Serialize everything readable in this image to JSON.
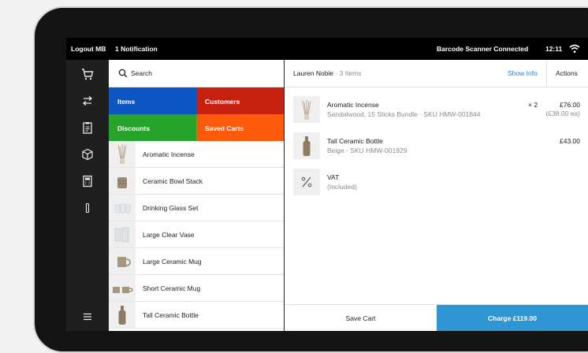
{
  "statusbar": {
    "logout_label": "Logout MB",
    "notifications_label": "1 Notification",
    "scanner_status": "Barcode Scanner Connected",
    "time": "12:11",
    "wifi_icon": "wifi-icon"
  },
  "sidebar": {
    "items": [
      {
        "name": "cart",
        "icon": "cart-icon"
      },
      {
        "name": "transactions",
        "icon": "arrows-swap-icon"
      },
      {
        "name": "reports",
        "icon": "clipboard-icon"
      },
      {
        "name": "items",
        "icon": "box-icon"
      },
      {
        "name": "calculator",
        "icon": "calculator-icon"
      },
      {
        "name": "device",
        "icon": "device-icon"
      },
      {
        "name": "menu",
        "icon": "hamburger-menu-icon"
      }
    ]
  },
  "catalog": {
    "search_label": "Search",
    "tiles": [
      {
        "label": "Items",
        "color": "#0e55c4"
      },
      {
        "label": "Customers",
        "color": "#c8200e"
      },
      {
        "label": "Discounts",
        "color": "#27a52a"
      },
      {
        "label": "Saved Carts",
        "color": "#ff5a0a"
      }
    ],
    "items": [
      {
        "name": "Aromatic Incense",
        "icon": "incense-icon"
      },
      {
        "name": "Ceramic Bowl Stack",
        "icon": "bowl-stack-icon"
      },
      {
        "name": "Drinking Glass Set",
        "icon": "glass-set-icon"
      },
      {
        "name": "Large Clear Vase",
        "icon": "vase-icon"
      },
      {
        "name": "Large Ceramic Mug",
        "icon": "mug-icon"
      },
      {
        "name": "Short Ceramic Mug",
        "icon": "mug-pair-icon"
      },
      {
        "name": "Tall Ceramic Bottle",
        "icon": "bottle-icon"
      }
    ]
  },
  "cart": {
    "customer": "Lauren Noble",
    "item_count": "· 3 Items",
    "show_info_label": "Show Info",
    "actions_label": "Actions",
    "lines": [
      {
        "name": "Aromatic Incense",
        "description": "Sandalwood, 15 Sticks Bundle · SKU HMW-001844",
        "qty": "× 2",
        "price": "£76.00",
        "sub": "(£38.00 ea)",
        "icon": "incense-icon"
      },
      {
        "name": "Tall Ceramic Bottle",
        "description": "Beige · SKU HMW-001929",
        "qty": "",
        "price": "£43.00",
        "sub": "",
        "icon": "bottle-icon"
      },
      {
        "name": "VAT",
        "description": "(Included)",
        "qty": "",
        "price": "",
        "sub": "",
        "icon": "percent-icon"
      }
    ],
    "save_cart_label": "Save Cart",
    "charge_label": "Charge £119.00",
    "accent_color": "#2d96d3"
  }
}
